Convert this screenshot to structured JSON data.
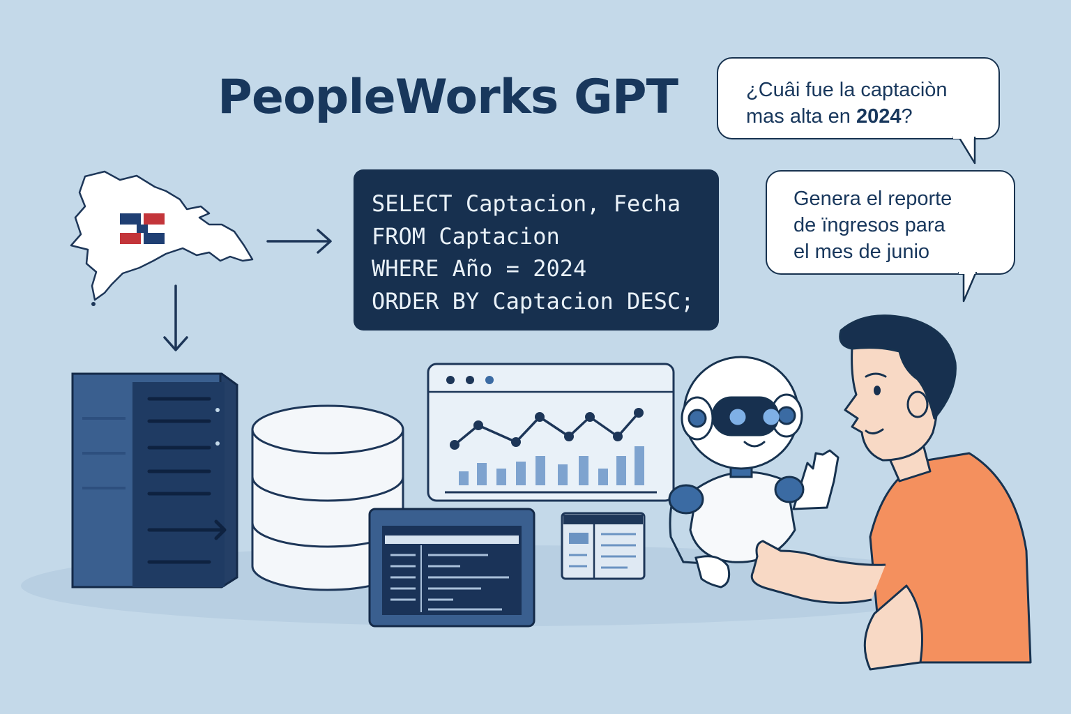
{
  "title": "PeopleWorks GPT",
  "bubbles": [
    {
      "lines": [
        "¿Cuâi fue la captaciòn"
      ],
      "line2_prefix": "mas alta en ",
      "line2_bold": "2024",
      "line2_suffix": "?"
    },
    {
      "lines": [
        "Genera el reporte",
        "de ïngresos para",
        "el mes de junio"
      ]
    }
  ],
  "sql": {
    "lines": [
      "SELECT Captacion, Fecha",
      "FROM Captacion",
      "WHERE Año = 2024",
      "ORDER BY Captacion DESC;"
    ]
  },
  "colors": {
    "background": "#c4d9e9",
    "navy": "#18375c",
    "sql_panel": "#17304f",
    "shirt": "#f4905e",
    "flag_blue": "#1f3f73",
    "flag_red": "#c3353a"
  },
  "icons": [
    "map-icon",
    "flag-icon",
    "arrow-right-icon",
    "arrow-down-icon",
    "server-icon",
    "database-icon",
    "chart-window-icon",
    "code-window-icon",
    "layout-window-icon",
    "robot-icon",
    "person-icon"
  ]
}
